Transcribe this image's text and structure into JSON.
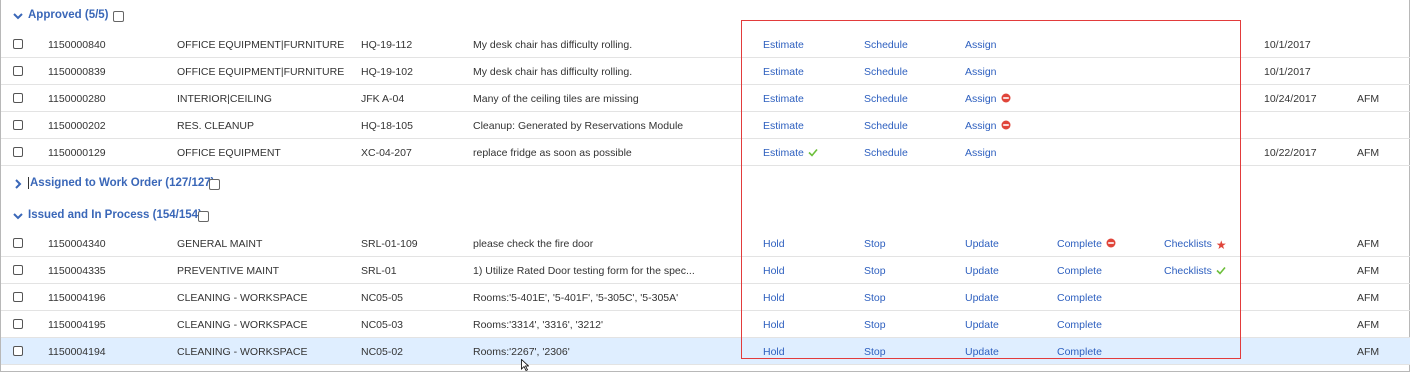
{
  "groups": {
    "approved": {
      "label": "Approved (5/5)"
    },
    "assigned": {
      "label": "Assigned to Work Order (127/127)"
    },
    "issued": {
      "label": "Issued and In Process (154/154)"
    }
  },
  "approved_rows": [
    {
      "id": "1150000840",
      "type": "OFFICE EQUIPMENT|FURNITURE",
      "location": "HQ-19-112",
      "description": "My desk chair has difficulty rolling.",
      "a1": "Estimate",
      "a2": "Schedule",
      "a3": "Assign",
      "date": "10/1/2017",
      "trade": ""
    },
    {
      "id": "1150000839",
      "type": "OFFICE EQUIPMENT|FURNITURE",
      "location": "HQ-19-102",
      "description": "My desk chair has difficulty rolling.",
      "a1": "Estimate",
      "a2": "Schedule",
      "a3": "Assign",
      "date": "10/1/2017",
      "trade": ""
    },
    {
      "id": "1150000280",
      "type": "INTERIOR|CEILING",
      "location": "JFK A-04",
      "description": "Many of the ceiling tiles are missing",
      "a1": "Estimate",
      "a2": "Schedule",
      "a3": "Assign",
      "date": "10/24/2017",
      "trade": "AFM"
    },
    {
      "id": "1150000202",
      "type": "RES. CLEANUP",
      "location": "HQ-18-105",
      "description": "Cleanup: Generated by Reservations Module",
      "a1": "Estimate",
      "a2": "Schedule",
      "a3": "Assign",
      "date": "",
      "trade": ""
    },
    {
      "id": "1150000129",
      "type": "OFFICE EQUIPMENT",
      "location": "XC-04-207",
      "description": "replace fridge as soon as possible",
      "a1": "Estimate",
      "a2": "Schedule",
      "a3": "Assign",
      "date": "10/22/2017",
      "trade": "AFM"
    }
  ],
  "issued_rows": [
    {
      "id": "1150004340",
      "type": "GENERAL MAINT",
      "location": "SRL-01-109",
      "description": "please check the fire door",
      "a1": "Hold",
      "a2": "Stop",
      "a3": "Update",
      "a4": "Complete",
      "a5": "Checklists",
      "date": "",
      "trade": "AFM"
    },
    {
      "id": "1150004335",
      "type": "PREVENTIVE MAINT",
      "location": "SRL-01",
      "description": "1) Utilize Rated Door testing form for the spec...",
      "a1": "Hold",
      "a2": "Stop",
      "a3": "Update",
      "a4": "Complete",
      "a5": "Checklists",
      "date": "",
      "trade": "AFM"
    },
    {
      "id": "1150004196",
      "type": "CLEANING - WORKSPACE",
      "location": "NC05-05",
      "description": "Rooms:'5-401E', '5-401F', '5-305C', '5-305A'",
      "a1": "Hold",
      "a2": "Stop",
      "a3": "Update",
      "a4": "Complete",
      "a5": "",
      "date": "",
      "trade": "AFM"
    },
    {
      "id": "1150004195",
      "type": "CLEANING - WORKSPACE",
      "location": "NC05-03",
      "description": "Rooms:'3314', '3316', '3212'",
      "a1": "Hold",
      "a2": "Stop",
      "a3": "Update",
      "a4": "Complete",
      "a5": "",
      "date": "",
      "trade": "AFM"
    },
    {
      "id": "1150004194",
      "type": "CLEANING - WORKSPACE",
      "location": "NC05-02",
      "description": "Rooms:'2267', '2306'",
      "a1": "Hold",
      "a2": "Stop",
      "a3": "Update",
      "a4": "Complete",
      "a5": "",
      "date": "",
      "trade": "AFM"
    }
  ],
  "icons": {
    "blocked": "blocked-icon",
    "ok": "checkmark-icon",
    "required": "star-icon"
  },
  "colors": {
    "link": "#2d5fbf",
    "group": "#3a67b8",
    "blocked": "#e0453a",
    "ok": "#6cbf3a",
    "highlight": "#e23b3b",
    "selected_row": "#dfeeff"
  }
}
